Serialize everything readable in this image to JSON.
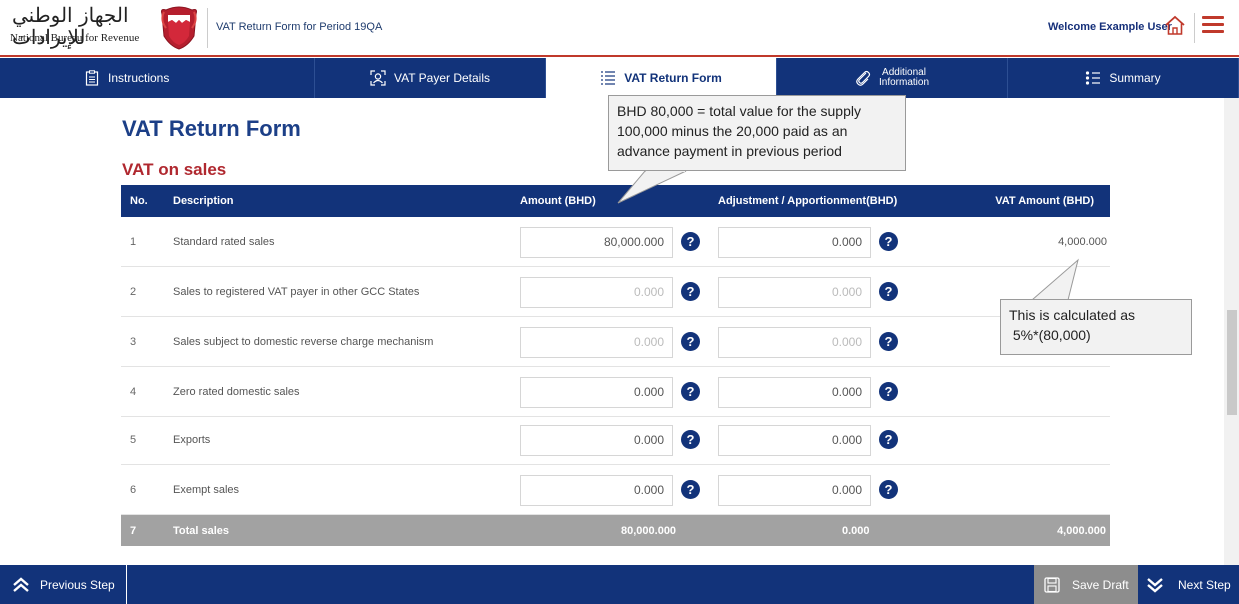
{
  "header": {
    "logo_arabic": "الجهاز الوطني للإيرادات",
    "logo_english": "National Bureau for Revenue",
    "title": "VAT Return Form for Period 19QA",
    "welcome": "Welcome Example User"
  },
  "tabs": [
    {
      "label": "Instructions",
      "icon": "document-list-icon"
    },
    {
      "label": "VAT Payer Details",
      "icon": "user-details-icon"
    },
    {
      "label": "VAT Return Form",
      "icon": "list-icon",
      "active": true
    },
    {
      "label_line1": "Additional",
      "label_line2": "Information",
      "icon": "paperclip-icon"
    },
    {
      "label": "Summary",
      "icon": "bulleted-list-icon"
    }
  ],
  "page": {
    "title": "VAT Return Form",
    "section": "VAT on sales"
  },
  "table": {
    "columns": [
      "No.",
      "Description",
      "Amount (BHD)",
      "Adjustment / Apportionment(BHD)",
      "VAT Amount (BHD)"
    ],
    "rows": [
      {
        "no": "1",
        "description": "Standard rated sales",
        "amount": "80,000.000",
        "adjustment": "0.000",
        "vat": "4,000.000"
      },
      {
        "no": "2",
        "description": "Sales to registered VAT payer in other GCC States",
        "amount": "0.000",
        "adjustment": "0.000",
        "vat": ""
      },
      {
        "no": "3",
        "description": "Sales subject to domestic reverse charge mechanism",
        "amount": "0.000",
        "adjustment": "0.000",
        "vat": ""
      },
      {
        "no": "4",
        "description": "Zero rated domestic sales",
        "amount": "0.000",
        "adjustment": "0.000",
        "vat": ""
      },
      {
        "no": "5",
        "description": "Exports",
        "amount": "0.000",
        "adjustment": "0.000",
        "vat": ""
      },
      {
        "no": "6",
        "description": "Exempt sales",
        "amount": "0.000",
        "adjustment": "0.000",
        "vat": ""
      }
    ],
    "total": {
      "no": "7",
      "label": "Total sales",
      "amount": "80,000.000",
      "adjustment": "0.000",
      "vat": "4,000.000"
    }
  },
  "help_glyph": "?",
  "callouts": {
    "amount_line1": "BHD 80,000  = total value for the supply",
    "amount_line2": "100,000  minus the 20,000  paid as an",
    "amount_line3": "advance payment in previous period",
    "vat_line1": "This is calculated as",
    "vat_line2": " 5%*(80,000)"
  },
  "footer": {
    "previous": "Previous Step",
    "save": "Save Draft",
    "next": "Next Step"
  },
  "colors": {
    "navy": "#12337a",
    "red": "#b0282f",
    "total_row": "#a2a2a2",
    "save_button": "#8d8d8d"
  }
}
